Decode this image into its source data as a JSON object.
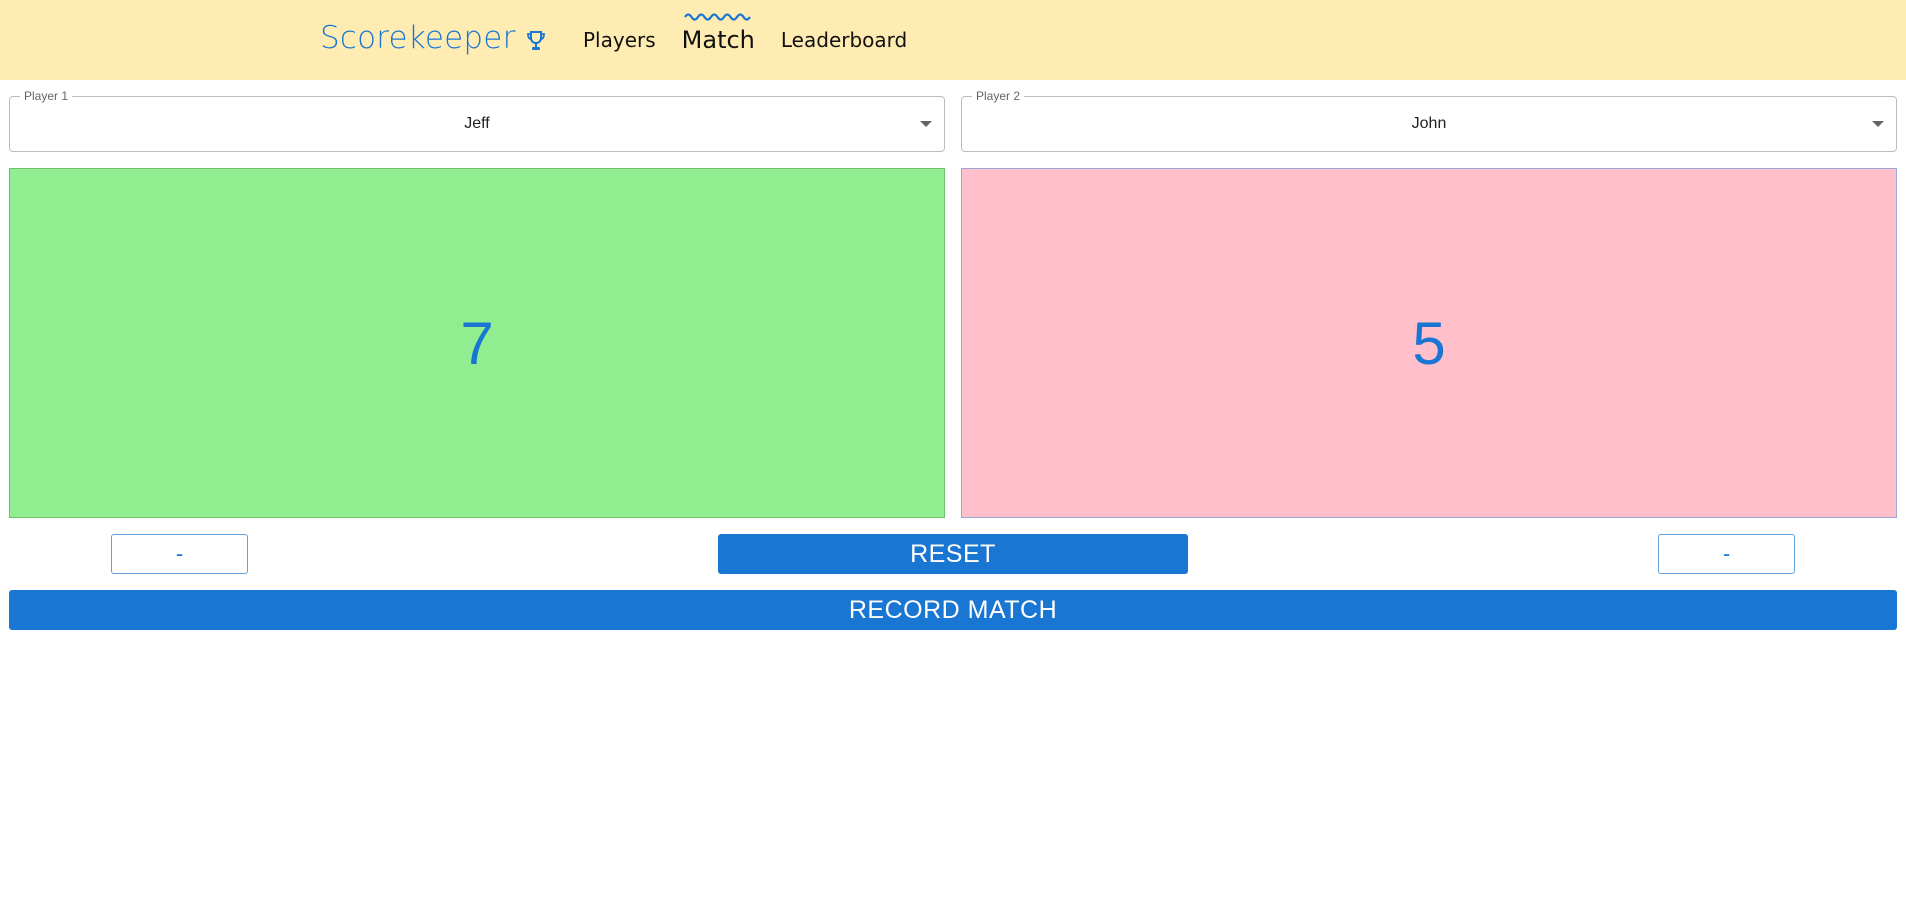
{
  "app": {
    "title": "Scorekeeper",
    "brand_icon": "trophy-icon",
    "colors": {
      "header_bg": "#ffecb3",
      "accent": "#1976d2",
      "player1_panel": "#90ee90",
      "player2_panel": "#ffc0cb"
    }
  },
  "nav": {
    "items": [
      {
        "label": "Players"
      },
      {
        "label": "Match"
      },
      {
        "label": "Leaderboard"
      }
    ],
    "active": "Match"
  },
  "match": {
    "player1": {
      "field_label": "Player 1",
      "selected": "Jeff",
      "score": "7",
      "decrement_label": "-"
    },
    "player2": {
      "field_label": "Player 2",
      "selected": "John",
      "score": "5",
      "decrement_label": "-"
    },
    "reset_label": "RESET",
    "record_label": "RECORD MATCH"
  }
}
